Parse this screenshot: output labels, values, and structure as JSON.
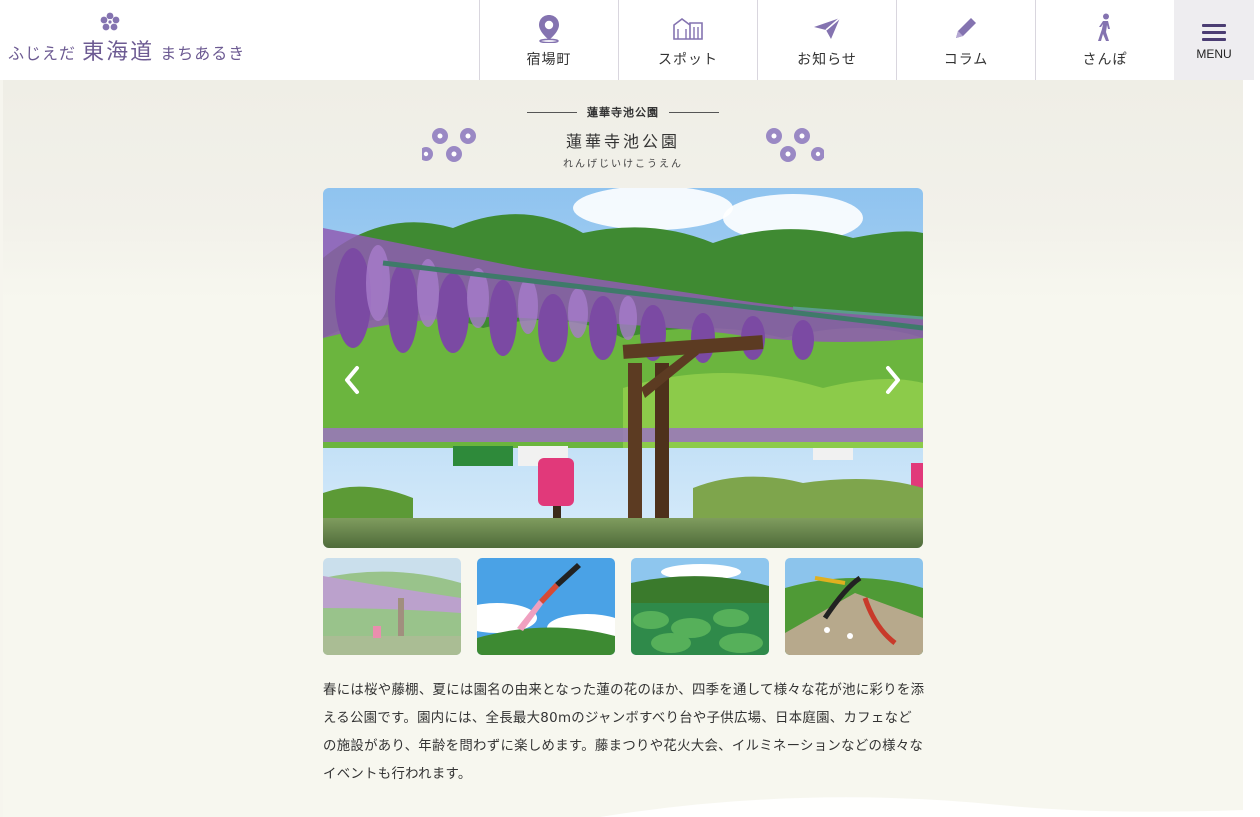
{
  "header": {
    "logo": {
      "small_left": "ふじえだ",
      "big": "東海道",
      "small_right": "まちあるき"
    },
    "nav": [
      {
        "label": "宿場町",
        "icon": "map-pin-icon"
      },
      {
        "label": "スポット",
        "icon": "building-icon"
      },
      {
        "label": "お知らせ",
        "icon": "paper-plane-icon"
      },
      {
        "label": "コラム",
        "icon": "pencil-icon"
      },
      {
        "label": "さんぽ",
        "icon": "walking-person-icon"
      }
    ],
    "menu_label": "MENU"
  },
  "page": {
    "breadcrumb": "蓮華寺池公園",
    "title": "蓮華寺池公園",
    "reading": "れんげじいけこうえん"
  },
  "slider": {
    "main_image": "wisteria-trellis-over-pond",
    "thumbnails": [
      {
        "subject": "wisteria-trellis",
        "active": true
      },
      {
        "subject": "koinobori-carp-streamer",
        "active": false
      },
      {
        "subject": "lotus-pond",
        "active": false
      },
      {
        "subject": "giant-slide-playground",
        "active": false
      }
    ]
  },
  "description": "春には桜や藤棚、夏には園名の由来となった蓮の花のほか、四季を通して様々な花が池に彩りを添える公園です。園内には、全長最大80mのジャンボすべり台や子供広場、日本庭園、カフェなどの施設があり、年齢を問わずに楽しめます。藤まつりや花火大会、イルミネーションなどの様々なイベントも行われます。",
  "colors": {
    "brand_purple": "#6c5a92",
    "icon_purple": "#8473b0",
    "page_bg": "#f6f5ee"
  }
}
